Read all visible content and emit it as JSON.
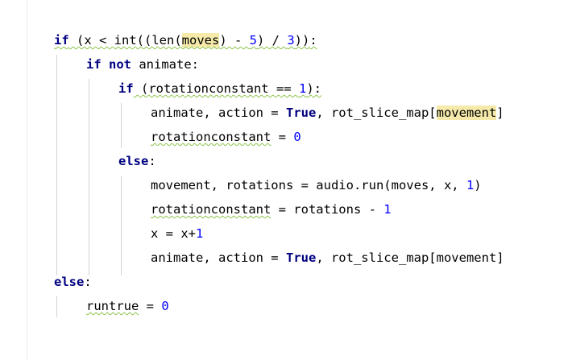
{
  "editor": {
    "lines": [
      [
        [
          "if",
          "kw"
        ],
        [
          " (x < int((len(",
          ""
        ],
        [
          "moves",
          "hl"
        ],
        [
          ") - ",
          ""
        ],
        [
          "5",
          "num"
        ],
        [
          ") / ",
          ""
        ],
        [
          "3",
          "num"
        ],
        [
          "))",
          ""
        ],
        [
          ":",
          ""
        ]
      ],
      [
        [
          "if",
          "kw"
        ],
        [
          " ",
          ""
        ],
        [
          "not",
          "kw"
        ],
        [
          " animate:",
          ""
        ]
      ],
      [
        [
          "if",
          "kw"
        ],
        [
          " (rotationconstant == ",
          ""
        ],
        [
          "1",
          "num"
        ],
        [
          "):",
          ""
        ]
      ],
      [
        [
          "animate, action = ",
          ""
        ],
        [
          "True",
          "kw"
        ],
        [
          ", rot_slice_map[",
          ""
        ],
        [
          "movement",
          "hl"
        ],
        [
          "]",
          ""
        ]
      ],
      [
        [
          "rotationconstant",
          ""
        ],
        [
          " = ",
          ""
        ],
        [
          "0",
          "num"
        ]
      ],
      [
        [
          "else",
          "kw"
        ],
        [
          ":",
          ""
        ]
      ],
      [
        [
          "movement, rotations = audio.run(moves, x, ",
          ""
        ],
        [
          "1",
          "num"
        ],
        [
          ")",
          ""
        ]
      ],
      [
        [
          "rotationconstant",
          ""
        ],
        [
          " = rotations - ",
          ""
        ],
        [
          "1",
          "num"
        ]
      ],
      [
        [
          "x = x+",
          ""
        ],
        [
          "1",
          "num"
        ]
      ],
      [
        [
          "animate, action = ",
          ""
        ],
        [
          "True",
          "kw"
        ],
        [
          ", rot_slice_map[movement]",
          ""
        ]
      ],
      [
        [
          "else",
          "kw"
        ],
        [
          ":",
          ""
        ]
      ],
      [
        [
          "runtrue",
          ""
        ],
        [
          " = ",
          ""
        ],
        [
          "0",
          "num"
        ]
      ]
    ]
  }
}
